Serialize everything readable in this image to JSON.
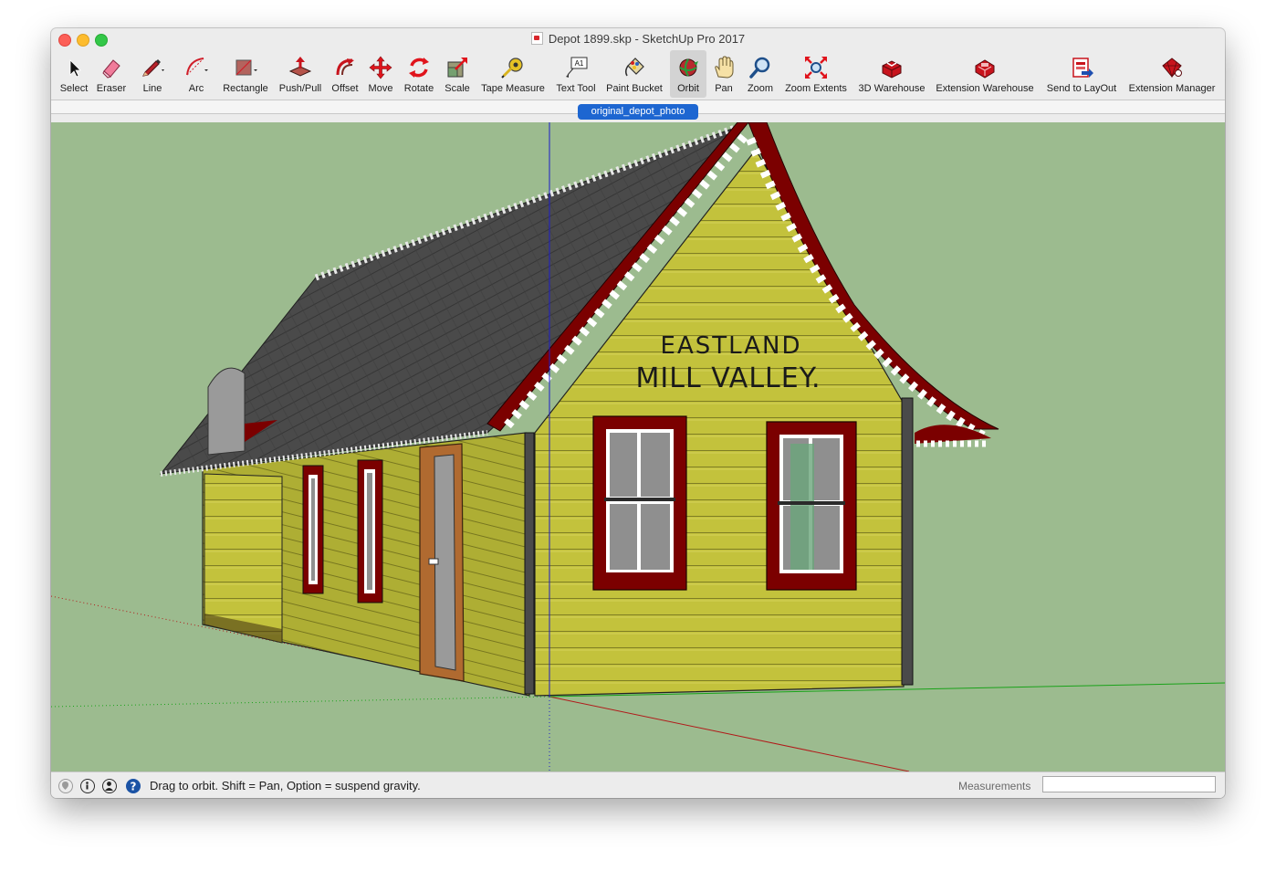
{
  "window": {
    "title": "Depot 1899.skp - SketchUp Pro 2017"
  },
  "toolbar": {
    "tools": [
      {
        "label": "Select",
        "icon": "arrow-cursor-icon"
      },
      {
        "label": "Eraser",
        "icon": "eraser-icon"
      },
      {
        "label": "Line",
        "icon": "pencil-icon"
      },
      {
        "label": "Arc",
        "icon": "arc-icon"
      },
      {
        "label": "Rectangle",
        "icon": "rectangle-icon"
      },
      {
        "label": "Push/Pull",
        "icon": "push-pull-icon"
      },
      {
        "label": "Offset",
        "icon": "offset-icon"
      },
      {
        "label": "Move",
        "icon": "move-arrows-icon"
      },
      {
        "label": "Rotate",
        "icon": "rotate-icon"
      },
      {
        "label": "Scale",
        "icon": "scale-icon"
      },
      {
        "label": "Tape Measure",
        "icon": "tape-measure-icon"
      },
      {
        "label": "Text Tool",
        "icon": "text-tool-icon"
      },
      {
        "label": "Paint Bucket",
        "icon": "paint-bucket-icon"
      },
      {
        "label": "Orbit",
        "icon": "orbit-icon",
        "active": true
      },
      {
        "label": "Pan",
        "icon": "pan-hand-icon"
      },
      {
        "label": "Zoom",
        "icon": "zoom-magnifier-icon"
      },
      {
        "label": "Zoom Extents",
        "icon": "zoom-extents-icon"
      },
      {
        "label": "3D Warehouse",
        "icon": "3d-warehouse-icon"
      },
      {
        "label": "Extension Warehouse",
        "icon": "extension-warehouse-icon"
      },
      {
        "label": "Send to LayOut",
        "icon": "send-to-layout-icon"
      },
      {
        "label": "Extension Manager",
        "icon": "extension-manager-icon"
      }
    ],
    "text_tool_glyph": "A1"
  },
  "scene": {
    "tab_label": "original_depot_photo"
  },
  "model": {
    "sign_line1": "EASTLAND",
    "sign_line2": "MILL VALLEY."
  },
  "colors": {
    "sky_ground": "#9cbb8f",
    "wall": "#c3c23c",
    "trim": "#7b0000",
    "roof": "#4b4b4b",
    "scene_tab": "#1d66d1"
  },
  "statusbar": {
    "hint": "Drag to orbit. Shift = Pan, Option = suspend gravity.",
    "measurements_label": "Measurements",
    "measurements_value": ""
  }
}
